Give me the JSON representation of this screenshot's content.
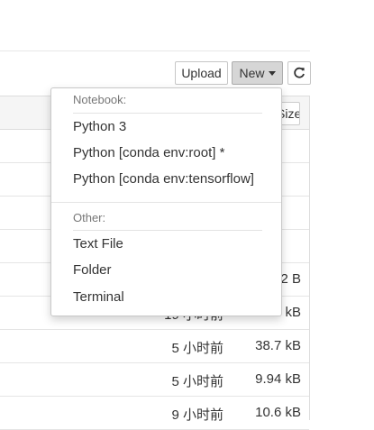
{
  "toolbar": {
    "upload_label": "Upload",
    "new_label": "New",
    "refresh_icon": "refresh-icon"
  },
  "file_list": {
    "size_sort_label": "Size",
    "rows": [
      {
        "time": "",
        "size": ""
      },
      {
        "time": "",
        "size": ""
      },
      {
        "time": "",
        "size": ""
      },
      {
        "time": "",
        "size": ""
      },
      {
        "time": "",
        "size": "2 B"
      },
      {
        "time": "19 小时前",
        "size": "10.9 kB"
      },
      {
        "time": "5 小时前",
        "size": "38.7 kB"
      },
      {
        "time": "5 小时前",
        "size": "9.94 kB"
      },
      {
        "time": "9 小时前",
        "size": "10.6 kB"
      }
    ]
  },
  "new_menu": {
    "notebook_header": "Notebook:",
    "notebook_items": [
      "Python 3",
      "Python [conda env:root] *",
      "Python [conda env:tensorflow]"
    ],
    "other_header": "Other:",
    "other_items": [
      "Text File",
      "Folder",
      "Terminal"
    ]
  }
}
